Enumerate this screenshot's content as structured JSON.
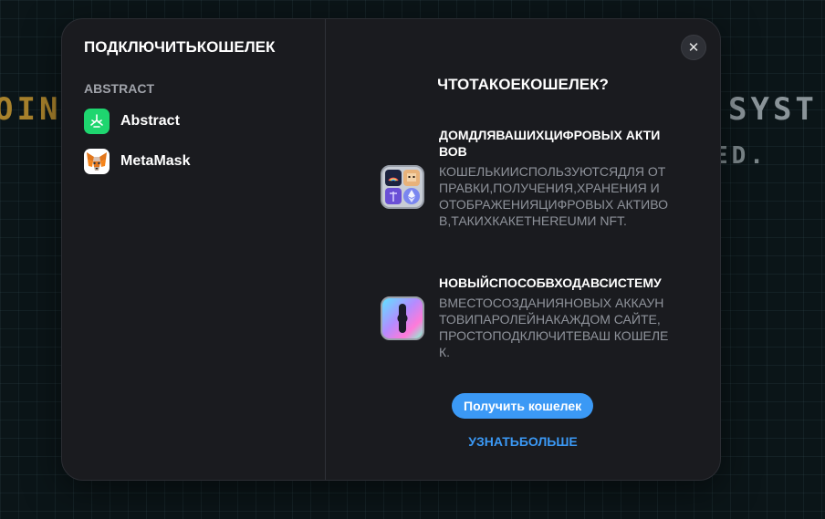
{
  "background": {
    "text_left": "OIN",
    "text_right": "SYST",
    "text_right2": "ED."
  },
  "modal": {
    "title": "ПОДКЛЮЧИТЬКОШЕЛЕК",
    "group_label": "ABSTRACT",
    "wallets": [
      {
        "name": "Abstract",
        "icon": "abstract-logo",
        "color": "#1ed66f"
      },
      {
        "name": "MetaMask",
        "icon": "metamask-fox",
        "color": "#f6851b"
      }
    ],
    "close_icon": "close-icon",
    "close_symbol": "✕"
  },
  "info": {
    "title": "ЧТОТАКОЕКОШЕЛЕК?",
    "features": [
      {
        "icon": "digital-assets-icon",
        "heading": "ДОМДЛЯВАШИХЦИФРОВЫХ АКТИВОВ",
        "description": "КОШЕЛЬКИИСПОЛЬЗУЮТСЯДЛЯ ОТПРАВКИ,ПОЛУЧЕНИЯ,ХРАНЕНИЯ ИОТОБРАЖЕНИЯЦИФРОВЫХ АКТИВОВ,ТАКИХКАКETHEREUMИ NFT."
      },
      {
        "icon": "keyhole-login-icon",
        "heading": "НОВЫЙСПОСОБВХОДАВСИСТЕМУ",
        "description": "ВМЕСТОСОЗДАНИЯНОВЫХ АККАУНТОВИПАРОЛЕЙНАКАЖДОМ САЙТЕ,ПРОСТОПОДКЛЮЧИТЕВАШ КОШЕЛЕК."
      }
    ],
    "get_wallet_label": "Получить кошелек",
    "learn_more_label": "УЗНАТЬБОЛЬШЕ",
    "accent_color": "#3b99f5"
  }
}
